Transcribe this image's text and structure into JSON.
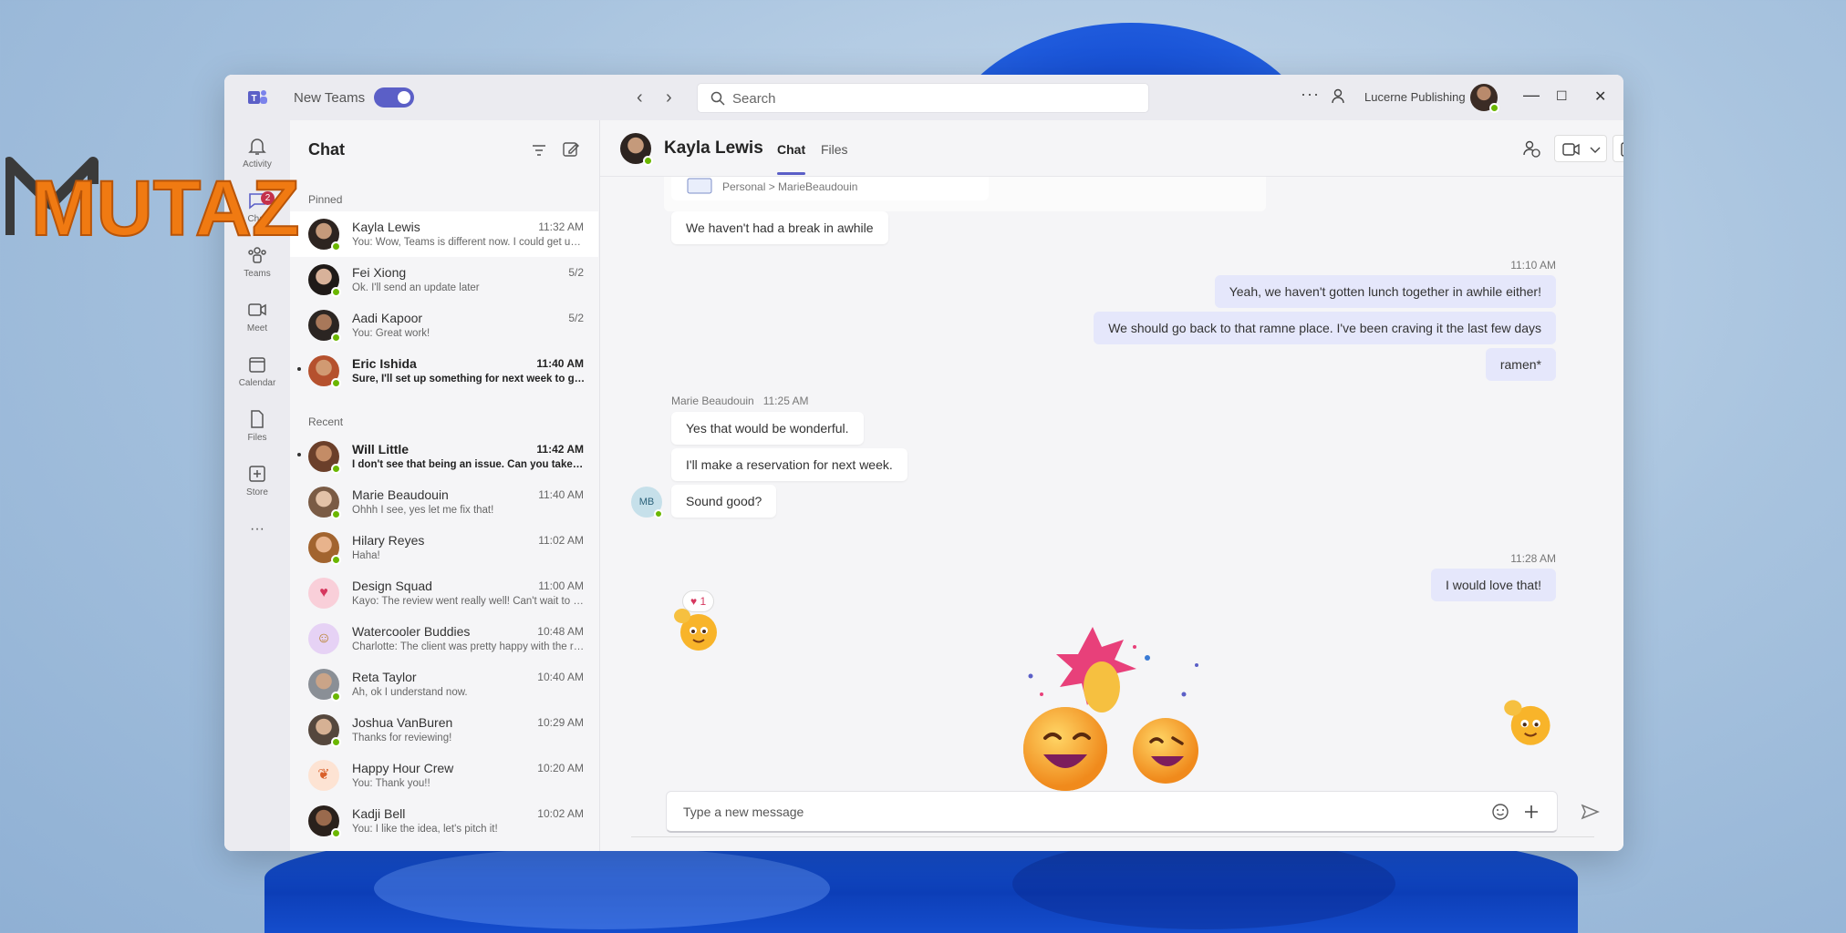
{
  "titlebar": {
    "new_teams_label": "New Teams",
    "search_placeholder": "Search",
    "more_label": "···",
    "org_name": "Lucerne Publishing",
    "minimize": "—",
    "maximize": "☐",
    "close": "✕",
    "back": "‹",
    "forward": "›"
  },
  "rail": {
    "items": [
      {
        "label": "Activity",
        "icon": "bell-icon"
      },
      {
        "label": "Chat",
        "icon": "chat-icon",
        "badge": "2"
      },
      {
        "label": "Teams",
        "icon": "teams-icon"
      },
      {
        "label": "Meet",
        "icon": "video-icon"
      },
      {
        "label": "Calendar",
        "icon": "calendar-icon"
      },
      {
        "label": "Files",
        "icon": "file-icon"
      },
      {
        "label": "Store",
        "icon": "plus-box-icon"
      }
    ],
    "more_label": "···"
  },
  "chatlist": {
    "title": "Chat",
    "pinned_label": "Pinned",
    "recent_label": "Recent",
    "pinned": [
      {
        "name": "Kayla Lewis",
        "time": "11:32 AM",
        "preview": "You: Wow, Teams is different now. I could get used to this.",
        "active": true,
        "unread": false
      },
      {
        "name": "Fei Xiong",
        "time": "5/2",
        "preview": "Ok. I'll send an update later",
        "active": false,
        "unread": false
      },
      {
        "name": "Aadi Kapoor",
        "time": "5/2",
        "preview": "You: Great work!",
        "active": false,
        "unread": false
      },
      {
        "name": "Eric Ishida",
        "time": "11:40 AM",
        "preview": "Sure, I'll set up something for next week to go over it",
        "active": false,
        "unread": true
      }
    ],
    "recent": [
      {
        "name": "Will Little",
        "time": "11:42 AM",
        "preview": "I don't see that being an issue. Can you take care of it?",
        "unread": true
      },
      {
        "name": "Marie Beaudouin",
        "time": "11:40 AM",
        "preview": "Ohhh I see, yes let me fix that!",
        "unread": false
      },
      {
        "name": "Hilary Reyes",
        "time": "11:02 AM",
        "preview": "Haha!",
        "unread": false
      },
      {
        "name": "Design Squad",
        "time": "11:00 AM",
        "preview": "Kayo: The review went really well! Can't wait to hear more",
        "unread": false
      },
      {
        "name": "Watercooler Buddies",
        "time": "10:48 AM",
        "preview": "Charlotte: The client was pretty happy with the results",
        "unread": false
      },
      {
        "name": "Reta Taylor",
        "time": "10:40 AM",
        "preview": "Ah, ok I understand now.",
        "unread": false
      },
      {
        "name": "Joshua VanBuren",
        "time": "10:29 AM",
        "preview": "Thanks for reviewing!",
        "unread": false
      },
      {
        "name": "Happy Hour Crew",
        "time": "10:20 AM",
        "preview": "You: Thank you!!",
        "unread": false
      },
      {
        "name": "Kadji Bell",
        "time": "10:02 AM",
        "preview": "You: I like the idea, let's pitch it!",
        "unread": false
      }
    ]
  },
  "conversation": {
    "contact_name": "Kayla Lewis",
    "tabs": [
      "Chat",
      "Files"
    ],
    "file_card_path": "Personal > MarieBeaudouin",
    "messages": {
      "in_1": "We haven't had a break in awhile",
      "time_out_1": "11:10 AM",
      "out_1": "Yeah, we haven't gotten lunch together in awhile either!",
      "out_2": "We should go back to that ramne place. I've been craving it the last few days",
      "out_3": "ramen*",
      "sender_meta": "Marie Beaudouin   11:25 AM",
      "sender_initials": "MB",
      "in_2": "Yes that would be wonderful.",
      "in_3": "I'll make a reservation for next week.",
      "in_4": "Sound good?",
      "reaction": "♥ 1",
      "time_out_2": "11:28 AM",
      "out_4": "I would love that!"
    },
    "composer_placeholder": "Type a new message"
  },
  "watermark": {
    "text": "MUTAZ"
  },
  "colors": {
    "accent": "#5b5fc7",
    "presence": "#6bb700",
    "outgoing_bubble": "#e5e7fb",
    "watermark_orange": "#f07a12"
  }
}
